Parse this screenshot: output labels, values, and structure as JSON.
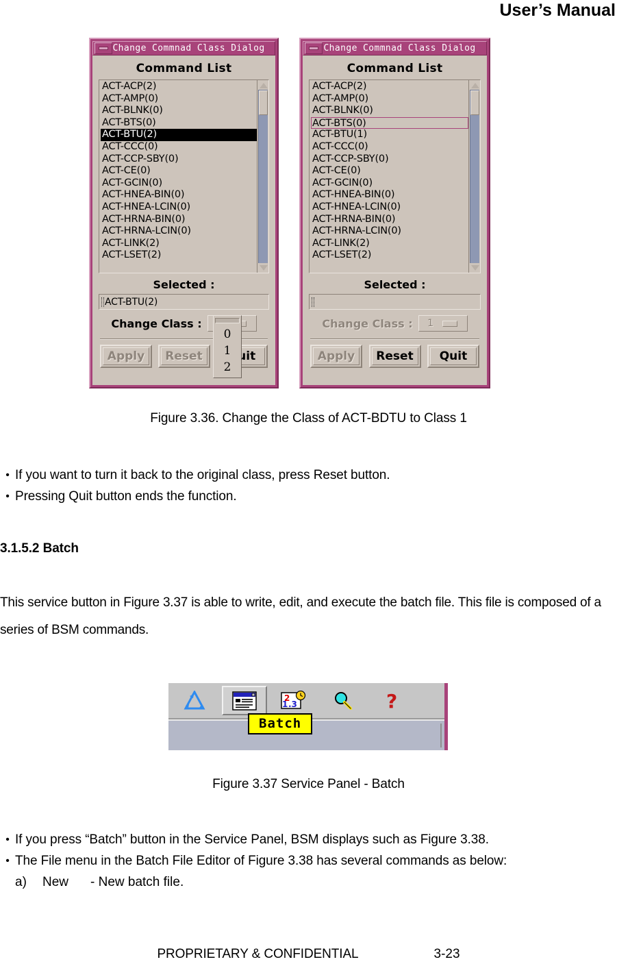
{
  "header": {
    "title": "User’s Manual"
  },
  "figure336": {
    "caption": "Figure 3.36. Change the Class of ACT-BDTU to Class 1",
    "colors": {
      "titlebar": "#a8437a",
      "dialog_face": "#cdc4bb",
      "scroll_track": "#8e98b3",
      "highlight_outline": "#a8437a"
    },
    "left_dialog": {
      "title": "Change Commnad Class Dialog",
      "minimize_icon": "minimize-icon",
      "list_label": "Command List",
      "commands": [
        "ACT-ACP(2)",
        "ACT-AMP(0)",
        "ACT-BLNK(0)",
        "ACT-BTS(0)",
        "ACT-BTU(2)",
        "ACT-CCC(0)",
        "ACT-CCP-SBY(0)",
        "ACT-CE(0)",
        "ACT-GCIN(0)",
        "ACT-HNEA-BIN(0)",
        "ACT-HNEA-LCIN(0)",
        "ACT-HRNA-BIN(0)",
        "ACT-HRNA-LCIN(0)",
        "ACT-LINK(2)",
        "ACT-LSET(2)"
      ],
      "selected_index": 4,
      "outlined_index": -1,
      "selected_label": "Selected :",
      "selected_value": "ACT-BTU(2)",
      "class_label": "Change Class :",
      "class_value": "",
      "class_options": [
        "0",
        "1",
        "2"
      ],
      "dropdown_open": true,
      "buttons": [
        {
          "label": "Apply",
          "disabled": true
        },
        {
          "label": "Reset",
          "disabled": true
        },
        {
          "label": "Quit",
          "disabled": false
        }
      ]
    },
    "right_dialog": {
      "title": "Change Commnad Class Dialog",
      "minimize_icon": "minimize-icon",
      "list_label": "Command List",
      "commands": [
        "ACT-ACP(2)",
        "ACT-AMP(0)",
        "ACT-BLNK(0)",
        "ACT-BTS(0)",
        "ACT-BTU(1)",
        "ACT-CCC(0)",
        "ACT-CCP-SBY(0)",
        "ACT-CE(0)",
        "ACT-GCIN(0)",
        "ACT-HNEA-BIN(0)",
        "ACT-HNEA-LCIN(0)",
        "ACT-HRNA-BIN(0)",
        "ACT-HRNA-LCIN(0)",
        "ACT-LINK(2)",
        "ACT-LSET(2)"
      ],
      "selected_index": -1,
      "outlined_index": 3,
      "selected_label": "Selected :",
      "selected_value": "",
      "class_label": "Change Class :",
      "class_value": "1",
      "class_disabled": true,
      "dropdown_open": false,
      "buttons": [
        {
          "label": "Apply",
          "disabled": true
        },
        {
          "label": "Reset",
          "disabled": false
        },
        {
          "label": "Quit",
          "disabled": false
        }
      ]
    }
  },
  "bullets_after_336": [
    "If you want to turn it back to the original class, press Reset button.",
    "Pressing Quit button ends the function."
  ],
  "section": {
    "heading": "3.1.5.2 Batch",
    "paragraph": "This service button in Figure 3.37 is able to write, edit, and execute the batch file. This file is composed of a series of BSM commands."
  },
  "figure337": {
    "caption": "Figure 3.37 Service Panel - Batch",
    "tooltip": "Batch",
    "tooltip_bg": "#ffff00",
    "toolbar_icons": [
      "recycle-triangle-icon",
      "batch-window-icon",
      "schedule-clock-icon",
      "magnifier-icon",
      "help-question-icon"
    ],
    "pressed_icon_index": 1
  },
  "bullets_after_337": [
    "If you press “Batch” button in the Service Panel, BSM displays such as Figure 3.38.",
    "The File menu in the Batch File Editor of Figure 3.38 has several commands as below:"
  ],
  "sub_items": [
    {
      "marker": "a)",
      "word": "New",
      "desc": "- New batch file."
    }
  ],
  "footer": {
    "confidential": "PROPRIETARY & CONFIDENTIAL",
    "page": "3-23"
  }
}
